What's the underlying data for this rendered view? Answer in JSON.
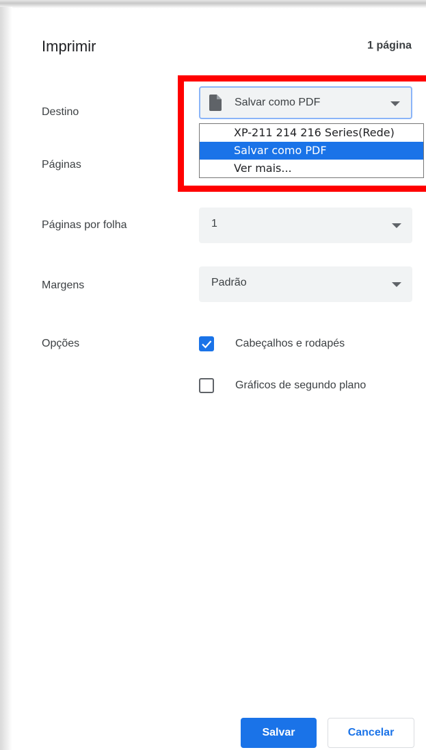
{
  "header": {
    "title": "Imprimir",
    "page_count": "1 página"
  },
  "destination": {
    "label": "Destino",
    "selected": "Salvar como PDF",
    "icon": "document-icon",
    "options": [
      "XP-211 214 216 Series(Rede)",
      "Salvar como PDF",
      "Ver mais..."
    ],
    "selected_index": 1
  },
  "pages": {
    "label": "Páginas"
  },
  "pages_per_sheet": {
    "label": "Páginas por folha",
    "value": "1"
  },
  "margins": {
    "label": "Margens",
    "value": "Padrão"
  },
  "options": {
    "label": "Opções",
    "headers_footers": {
      "label": "Cabeçalhos e rodapés",
      "checked": true
    },
    "background_graphics": {
      "label": "Gráficos de segundo plano",
      "checked": false
    }
  },
  "footer": {
    "save_label": "Salvar",
    "cancel_label": "Cancelar"
  },
  "colors": {
    "accent": "#1a73e8",
    "highlight": "#ff0000",
    "field_bg": "#f1f3f4"
  }
}
